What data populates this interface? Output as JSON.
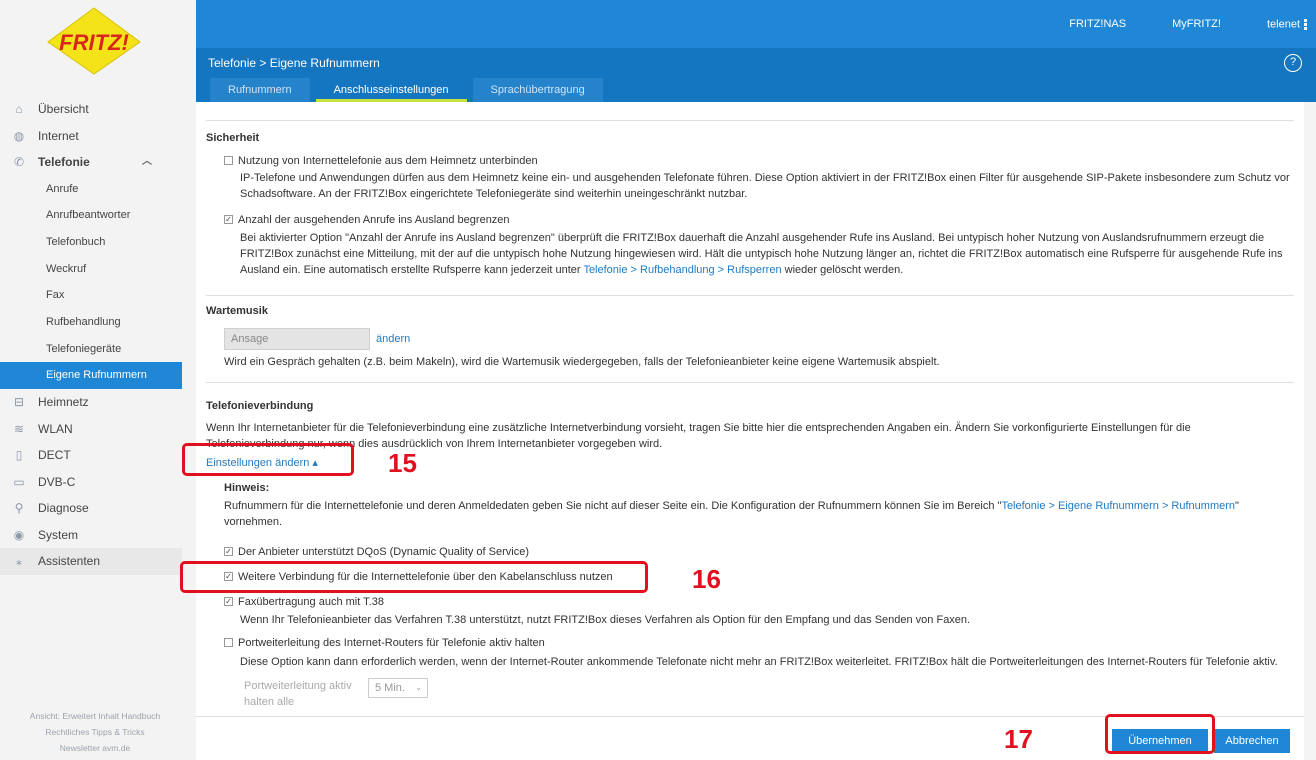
{
  "app": {
    "logo_text": "FRITZ!"
  },
  "topbar": {
    "links": [
      "FRITZ!NAS",
      "MyFRITZ!",
      "telenet"
    ]
  },
  "header": {
    "breadcrumb": "Telefonie > Eigene Rufnummern",
    "help_label": "?",
    "tabs": [
      {
        "label": "Rufnummern",
        "active": false
      },
      {
        "label": "Anschlusseinstellungen",
        "active": true
      },
      {
        "label": "Sprachübertragung",
        "active": false
      }
    ]
  },
  "sidebar": {
    "items": [
      {
        "label": "Übersicht",
        "icon": "home-icon"
      },
      {
        "label": "Internet",
        "icon": "globe-icon"
      },
      {
        "label": "Telefonie",
        "icon": "phone-icon"
      }
    ],
    "sub_items": [
      "Anrufe",
      "Anrufbeantworter",
      "Telefonbuch",
      "Weckruf",
      "Fax",
      "Rufbehandlung",
      "Telefoniegeräte",
      "Eigene Rufnummern"
    ],
    "items2": [
      {
        "label": "Heimnetz",
        "icon": "network-icon"
      },
      {
        "label": "WLAN",
        "icon": "wifi-icon"
      },
      {
        "label": "DECT",
        "icon": "dect-icon"
      },
      {
        "label": "DVB-C",
        "icon": "tv-icon"
      },
      {
        "label": "Diagnose",
        "icon": "diagnose-icon"
      },
      {
        "label": "System",
        "icon": "system-icon"
      },
      {
        "label": "Assistenten",
        "icon": "assistant-icon"
      }
    ],
    "footer": {
      "line1": "Ansicht: Erweitert  Inhalt  Handbuch",
      "line2": "Rechtliches  Tipps & Tricks",
      "line3": "Newsletter  avm.de"
    }
  },
  "sicherheit": {
    "title": "Sicherheit",
    "opt1_label": "Nutzung von Internettelefonie aus dem Heimnetz unterbinden",
    "opt1_desc1": "IP-Telefone und Anwendungen dürfen aus dem Heimnetz keine ein- und ausgehenden Telefonate führen. Diese Option aktiviert in der FRITZ!Box einen Filter für ausgehende SIP-Pakete insbesondere zum Schutz vor",
    "opt1_desc2": "Schadsoftware. An der FRITZ!Box eingerichtete Telefoniegeräte sind weiterhin uneingeschränkt nutzbar.",
    "opt2_label": "Anzahl der ausgehenden Anrufe ins Ausland begrenzen",
    "opt2_desc1": "Bei aktivierter Option \"Anzahl der Anrufe ins Ausland begrenzen\" überprüft die FRITZ!Box dauerhaft die Anzahl ausgehender Rufe ins Ausland. Bei untypisch hoher Nutzung von Auslandsrufnummern erzeugt die",
    "opt2_desc2": "FRITZ!Box zunächst eine Mitteilung, mit der auf die untypisch hohe Nutzung hingewiesen wird. Hält die untypisch hohe Nutzung länger an, richtet die FRITZ!Box automatisch eine Rufsperre für ausgehende Rufe ins",
    "opt2_desc3_a": "Ausland ein. Eine automatisch erstellte Rufsperre kann jederzeit unter ",
    "opt2_desc3_link": "Telefonie > Rufbehandlung > Rufsperren",
    "opt2_desc3_b": " wieder gelöscht werden."
  },
  "wartemusik": {
    "title": "Wartemusik",
    "input_value": "Ansage",
    "change_link": "ändern",
    "desc": "Wird ein Gespräch gehalten (z.B. beim Makeln), wird die Wartemusik wiedergegeben, falls der Telefonieanbieter keine eigene Wartemusik abspielt."
  },
  "verbindung": {
    "title": "Telefonieverbindung",
    "desc1": "Wenn Ihr Internetanbieter für die Telefonieverbindung eine zusätzliche Internetverbindung vorsieht, tragen Sie bitte hier die entsprechenden Angaben ein. Ändern Sie vorkonfigurierte Einstellungen für die",
    "desc2": "Telefonieverbindung nur, wenn dies ausdrücklich von Ihrem Internetanbieter vorgegeben wird.",
    "toggle_link": "Einstellungen ändern ▴",
    "hint_title": "Hinweis:",
    "hint1_a": "Rufnummern für die Internettelefonie und deren Anmeldedaten geben Sie nicht auf dieser Seite ein. Die Konfiguration der Rufnummern können Sie im Bereich \"",
    "hint1_link": "Telefonie > Eigene Rufnummern > Rufnummern",
    "hint1_b": "\"",
    "hint2": "vornehmen.",
    "opt_dqos": "Der Anbieter unterstützt DQoS (Dynamic Quality of Service)",
    "opt_kabel": "Weitere Verbindung für die Internettelefonie über den Kabelanschluss nutzen",
    "opt_fax": "Faxübertragung auch mit T.38",
    "opt_fax_desc": "Wenn Ihr Telefonieanbieter das Verfahren T.38 unterstützt, nutzt FRITZ!Box dieses Verfahren als Option für den Empfang und das Senden von Faxen.",
    "opt_port": "Portweiterleitung des Internet-Routers für Telefonie aktiv halten",
    "opt_port_desc": "Diese Option kann dann erforderlich werden, wenn der Internet-Router ankommende Telefonate nicht mehr an FRITZ!Box weiterleitet. FRITZ!Box hält die Portweiterleitungen des Internet-Routers für Telefonie aktiv.",
    "port_label1": "Portweiterleitung aktiv",
    "port_label2": "halten alle",
    "port_select": "5 Min."
  },
  "footer": {
    "apply": "Übernehmen",
    "cancel": "Abbrechen"
  },
  "annotations": {
    "n15": "15",
    "n16": "16",
    "n17": "17"
  },
  "colors": {
    "accent": "#1f87d6",
    "annotation": "#e0101e"
  }
}
